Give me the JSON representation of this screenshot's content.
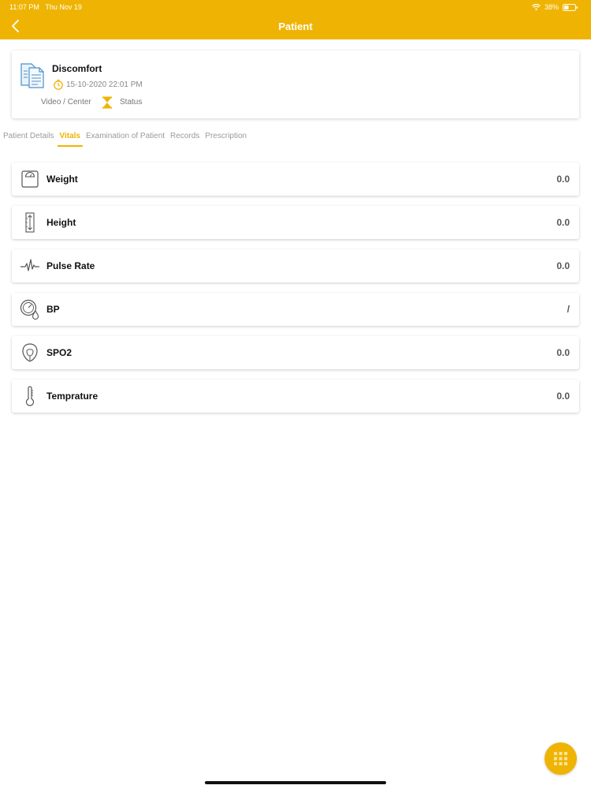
{
  "status_bar": {
    "time": "11:07 PM",
    "date": "Thu Nov 19",
    "battery": "38%"
  },
  "header": {
    "title": "Patient"
  },
  "case": {
    "title": "Discomfort",
    "datetime": "15-10-2020 22:01 PM",
    "type": "Video / Center",
    "status_label": "Status"
  },
  "tabs": [
    {
      "label": "Patient Details",
      "active": false
    },
    {
      "label": "Vitals",
      "active": true
    },
    {
      "label": "Examination of Patient",
      "active": false
    },
    {
      "label": "Records",
      "active": false
    },
    {
      "label": "Prescription",
      "active": false
    }
  ],
  "vitals": [
    {
      "label": "Weight",
      "value": "0.0",
      "icon": "weight-scale-icon"
    },
    {
      "label": "Height",
      "value": "0.0",
      "icon": "height-icon"
    },
    {
      "label": "Pulse Rate",
      "value": "0.0",
      "icon": "pulse-icon"
    },
    {
      "label": "BP",
      "value": "/",
      "icon": "blood-pressure-icon"
    },
    {
      "label": "SPO2",
      "value": "0.0",
      "icon": "oxygen-mask-icon"
    },
    {
      "label": "Temprature",
      "value": "0.0",
      "icon": "thermometer-icon"
    }
  ],
  "colors": {
    "accent": "#EFB403",
    "doc_icon": "#4A90C8"
  }
}
